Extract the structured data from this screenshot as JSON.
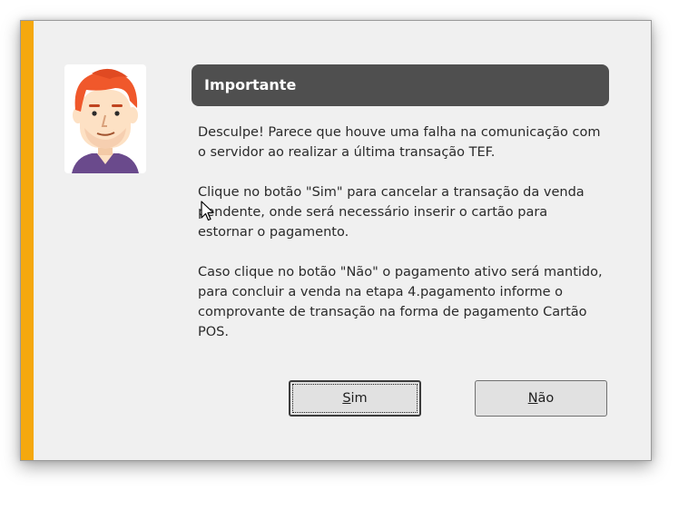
{
  "dialog": {
    "title": "Importante",
    "message": {
      "p1": "Desculpe! Parece que houve uma falha na comunicação com o servidor ao realizar a última transação TEF.",
      "p2": "Clique no botão \"Sim\" para cancelar a transação da venda pendente, onde será necessário inserir o cartão para estornar o pagamento.",
      "p3": "Caso clique no botão \"Não\" o pagamento ativo será mantido, para concluir a venda na etapa 4.pagamento informe o comprovante de transação na forma de pagamento Cartão POS."
    },
    "buttons": {
      "yes": {
        "mnemonic": "S",
        "rest": "im"
      },
      "no": {
        "mnemonic": "N",
        "rest": "ão"
      }
    },
    "icons": {
      "avatar": "assistant-avatar-icon",
      "cursor": "mouse-cursor-icon"
    },
    "colors": {
      "accent": "#f5a80e",
      "title_bar": "#4f4f4f",
      "avatar_hair": "#f0582b",
      "avatar_skin": "#fde1c4",
      "avatar_shirt": "#6a4a8c"
    }
  }
}
